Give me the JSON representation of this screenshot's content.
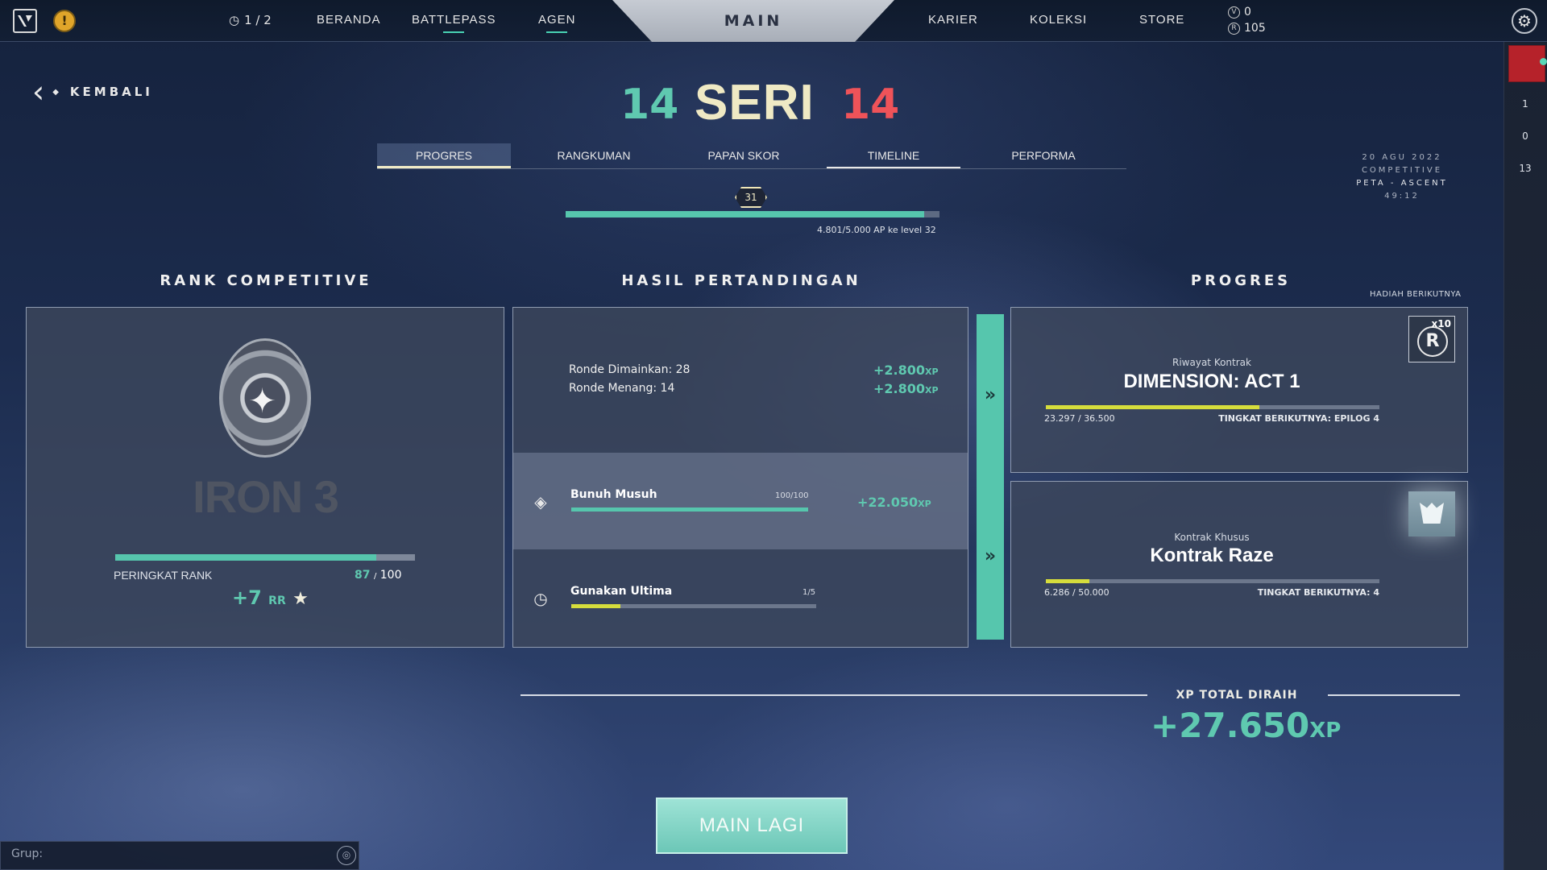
{
  "topbar": {
    "queue_status": "1 / 2",
    "nav_left": [
      "BERANDA",
      "BATTLEPASS",
      "AGEN"
    ],
    "main_tab": "MAIN",
    "nav_right": [
      "KARIER",
      "KOLEKSI",
      "STORE"
    ],
    "currency": {
      "vp": "0",
      "radianite": "105"
    },
    "icons": {
      "logo": "valorant-logo-icon",
      "alert": "alert-icon",
      "settings": "gear-icon"
    }
  },
  "sidebar": {
    "counts": [
      "1",
      "0",
      "13"
    ]
  },
  "header": {
    "back_label": "KEMBALI",
    "score_left": "14",
    "result": "SERI",
    "score_right": "14"
  },
  "tabs": [
    "PROGRES",
    "RANGKUMAN",
    "PAPAN SKOR",
    "TIMELINE",
    "PERFORMA"
  ],
  "match_info": {
    "date": "20 AGU 2022",
    "mode": "COMPETITIVE",
    "map": "PETA - ASCENT",
    "duration": "49:12"
  },
  "account_level": {
    "level": "31",
    "progress_fraction": 0.96,
    "caption": "4.801/5.000 AP ke level 32"
  },
  "rank": {
    "heading": "RANK COMPETITIVE",
    "rank_name": "IRON 3",
    "bar_label": "PERINGKAT RANK",
    "current": "87",
    "max": "100",
    "progress_fraction": 0.87,
    "gain": "+7",
    "gain_unit": "RR",
    "gain_icon": "★"
  },
  "match_result": {
    "heading": "HASIL PERTANDINGAN",
    "rounds_played": "Ronde Dimainkan: 28",
    "rounds_won": "Ronde Menang: 14",
    "xp_played": "+2.800",
    "xp_won": "+2.800",
    "xp_unit": "XP",
    "objectives": [
      {
        "title": "Bunuh Musuh",
        "count": "100/100",
        "progress": 1.0,
        "xp": "+22.050",
        "icon": "kill-icon"
      },
      {
        "title": "Gunakan Ultima",
        "count": "1/5",
        "progress": 0.2,
        "icon": "clock-icon"
      }
    ]
  },
  "progress": {
    "heading": "PROGRES",
    "next_reward_label": "HADIAH BERIKUTNYA",
    "contracts": [
      {
        "subtitle": "Riwayat Kontrak",
        "title": "DIMENSION: ACT 1",
        "value_text": "23.297 / 36.500",
        "progress": 0.64,
        "next_tier": "TINGKAT BERIKUTNYA: EPILOG 4",
        "reward_multiplier": "x10",
        "reward_icon": "radianite-icon"
      },
      {
        "subtitle": "Kontrak Khusus",
        "title": "Kontrak Raze",
        "value_text": "6.286 / 50.000",
        "progress": 0.13,
        "next_tier": "TINGKAT BERIKUTNYA: 4",
        "reward_icon": "spray-reward-icon"
      }
    ]
  },
  "total_xp": {
    "label": "XP TOTAL DIRAIH",
    "value": "+27.650",
    "unit": "XP"
  },
  "play_again": "MAIN LAGI",
  "chat": {
    "label": "Grup:"
  },
  "colors": {
    "accent_teal": "#56c6ad",
    "result_cream": "#efe9c4",
    "enemy_red": "#ef5359",
    "contract_yellow": "#d6dd3c"
  }
}
